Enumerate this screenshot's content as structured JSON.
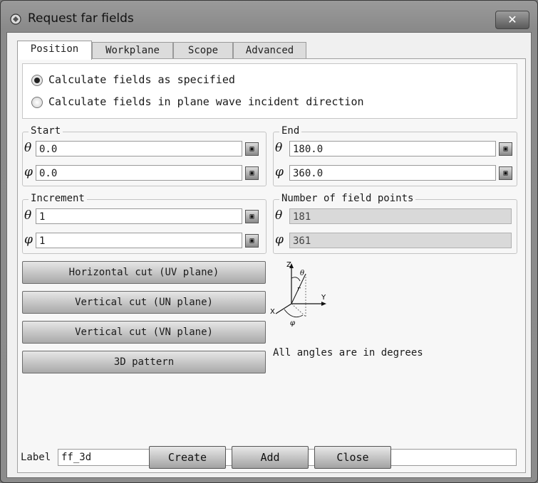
{
  "window": {
    "title": "Request far fields",
    "close_label": "✕"
  },
  "tabs": [
    {
      "label": "Position"
    },
    {
      "label": "Workplane"
    },
    {
      "label": "Scope"
    },
    {
      "label": "Advanced"
    }
  ],
  "radios": [
    {
      "label": "Calculate fields as specified",
      "checked": true
    },
    {
      "label": "Calculate fields in plane wave incident direction",
      "checked": false
    }
  ],
  "symbols": {
    "theta": "θ",
    "phi": "φ"
  },
  "start": {
    "title": "Start",
    "theta": "0.0",
    "phi": "0.0"
  },
  "end": {
    "title": "End",
    "theta": "180.0",
    "phi": "360.0"
  },
  "increment": {
    "title": "Increment",
    "theta": "1",
    "phi": "1"
  },
  "points": {
    "title": "Number of field points",
    "theta": "181",
    "phi": "361"
  },
  "cut_buttons": [
    {
      "label": "Horizontal cut (UV plane)"
    },
    {
      "label": "Vertical cut (UN plane)"
    },
    {
      "label": "Vertical cut (VN plane)"
    },
    {
      "label": "3D pattern"
    }
  ],
  "diagram": {
    "z": "Z",
    "y": "Y",
    "x": "X",
    "r": "r",
    "theta": "θ",
    "phi": "φ"
  },
  "note": "All angles are in degrees",
  "label_row": {
    "label": "Label",
    "value": "ff_3d"
  },
  "buttons": {
    "create": "Create",
    "add": "Add",
    "close": "Close"
  },
  "var_button_glyph": "▣"
}
